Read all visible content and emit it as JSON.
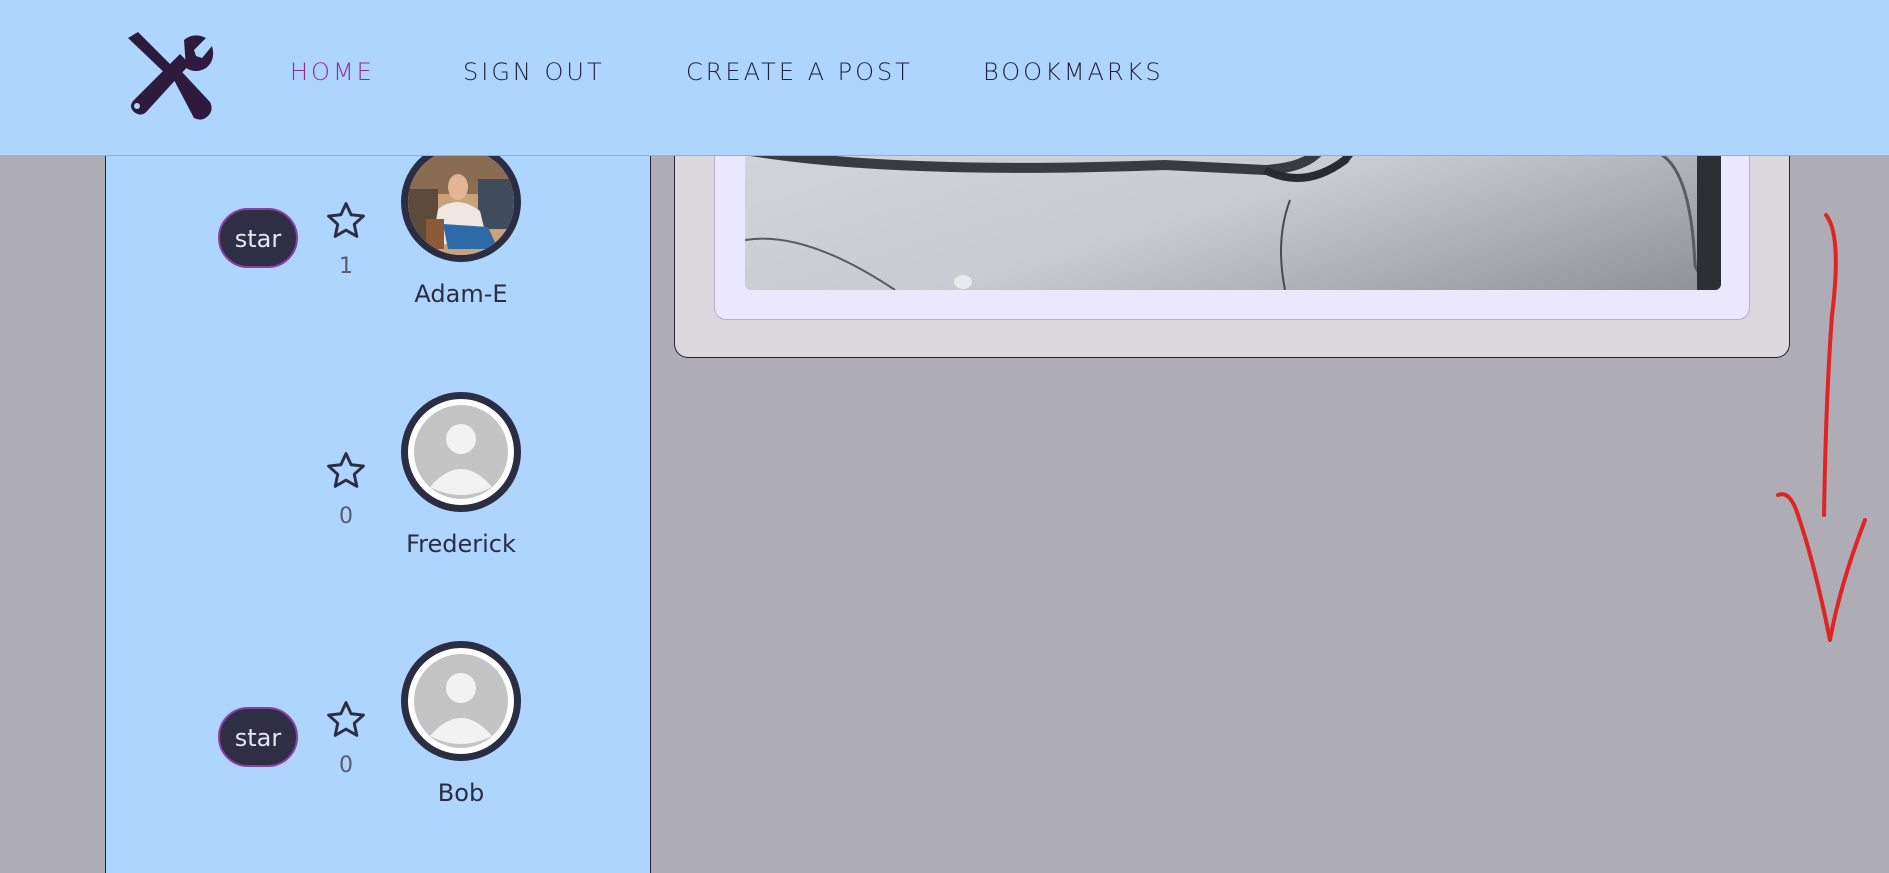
{
  "header": {
    "logo_icon": "tools-icon",
    "nav": [
      "HOME",
      "SIGN OUT",
      "CREATE A POST",
      "BOOKMARKS"
    ],
    "active_index": 0,
    "active_color": "#93299c",
    "background": "#aed5fe"
  },
  "sidebar": {
    "users": [
      {
        "name": "Adam-E",
        "stars": "1",
        "star_button": "star",
        "avatar": "photo-avatar"
      },
      {
        "name": "Frederick",
        "stars": "0",
        "star_button": "",
        "avatar": "default-avatar"
      },
      {
        "name": "Bob",
        "stars": "0",
        "star_button": "star",
        "avatar": "default-avatar"
      }
    ]
  },
  "post": {
    "image": "car-photo"
  },
  "annotation": {
    "icon": "red-arrow-down-icon",
    "color": "#e02424"
  }
}
